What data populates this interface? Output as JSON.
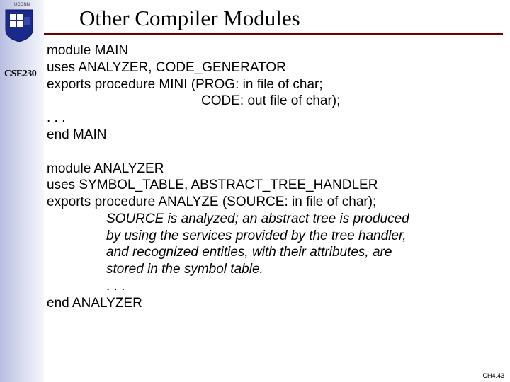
{
  "sidebar": {
    "institution": "UCONN",
    "course": "CSE230"
  },
  "title": "Other Compiler Modules",
  "main_module": {
    "line1": "module MAIN",
    "line2": "uses ANALYZER, CODE_GENERATOR",
    "line3": "exports procedure MINI (PROG: in file of char;",
    "line4": "CODE: out file of char);",
    "line5": ". . .",
    "line6": "end MAIN"
  },
  "analyzer_module": {
    "line1": "module ANALYZER",
    "line2": "uses SYMBOL_TABLE, ABSTRACT_TREE_HANDLER",
    "line3": "exports procedure ANALYZE (SOURCE: in file of char);",
    "desc1": "SOURCE is analyzed; an abstract tree is produced",
    "desc2": "by using the services provided by the tree handler,",
    "desc3": "and recognized entities, with their attributes, are",
    "desc4": "stored in the symbol table.",
    "line4": ". . .",
    "line5": "end ANALYZER"
  },
  "footer": "CH4.43"
}
